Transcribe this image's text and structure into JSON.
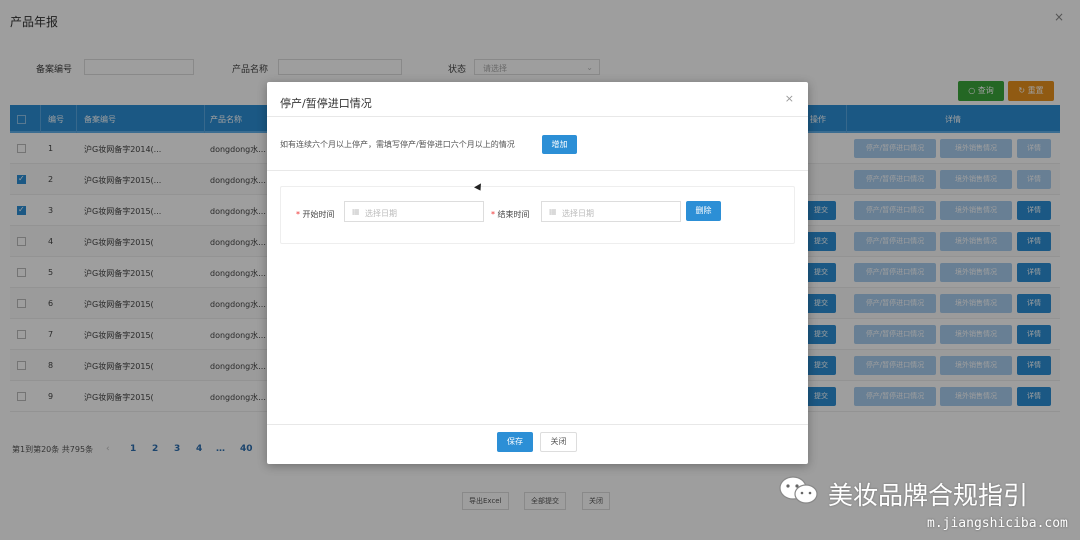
{
  "page": {
    "title": "产品年报",
    "close": "×"
  },
  "filters": {
    "record_no_label": "备案编号",
    "product_name_label": "产品名称",
    "status_label": "状态",
    "status_value": "请选择",
    "search_label": "查询",
    "reset_label": "重置"
  },
  "table": {
    "headers": [
      "编号",
      "备案编号",
      "产品名称",
      "操作",
      "详情"
    ],
    "rows": [
      {
        "no": "1",
        "record": "沪G妆网备字2014(...",
        "name": "dongdong水...",
        "checked": false
      },
      {
        "no": "2",
        "record": "沪G妆网备字2015(...",
        "name": "dongdong水...",
        "checked": true
      },
      {
        "no": "3",
        "record": "沪G妆网备字2015(...",
        "name": "dongdong水...",
        "checked": true
      },
      {
        "no": "4",
        "record": "沪G妆网备字2015(",
        "name": "dongdong水...",
        "checked": false
      },
      {
        "no": "5",
        "record": "沪G妆网备字2015(",
        "name": "dongdong水...",
        "checked": false
      },
      {
        "no": "6",
        "record": "沪G妆网备字2015(",
        "name": "dongdong水...",
        "checked": false
      },
      {
        "no": "7",
        "record": "沪G妆网备字2015(",
        "name": "dongdong水...",
        "checked": false
      },
      {
        "no": "8",
        "record": "沪G妆网备字2015(",
        "name": "dongdong水...",
        "checked": false
      },
      {
        "no": "9",
        "record": "沪G妆网备字2015(",
        "name": "dongdong水...",
        "checked": false
      }
    ],
    "submit_label": "提交",
    "stop_label": "停产/暂停进口情况",
    "overseas_label": "境外销售情况",
    "detail_label": "详情"
  },
  "pager": {
    "summary": "第1到第20条 共795条",
    "prev": "‹",
    "pages": [
      "1",
      "2",
      "3",
      "4",
      "…",
      "40"
    ]
  },
  "bottom_actions": {
    "export": "导出Excel",
    "submit_all": "全部提交",
    "close": "关闭"
  },
  "modal": {
    "title": "停产/暂停进口情况",
    "close": "×",
    "hint": "如有连续六个月以上停产，需填写停产/暂停进口六个月以上的情况",
    "add_label": "增加",
    "start_label": "开始时间",
    "start_placeholder": "选择日期",
    "end_label": "结束时间",
    "end_placeholder": "选择日期",
    "delete_label": "删除",
    "save_label": "保存",
    "close_label": "关闭",
    "required_mark": "*"
  },
  "watermark": {
    "text": "美妆品牌合规指引",
    "url": "m.jiangshiciba.com"
  },
  "colors": {
    "primary": "#2c8fd6",
    "search": "#3aa63a",
    "reset": "#e8921d"
  }
}
